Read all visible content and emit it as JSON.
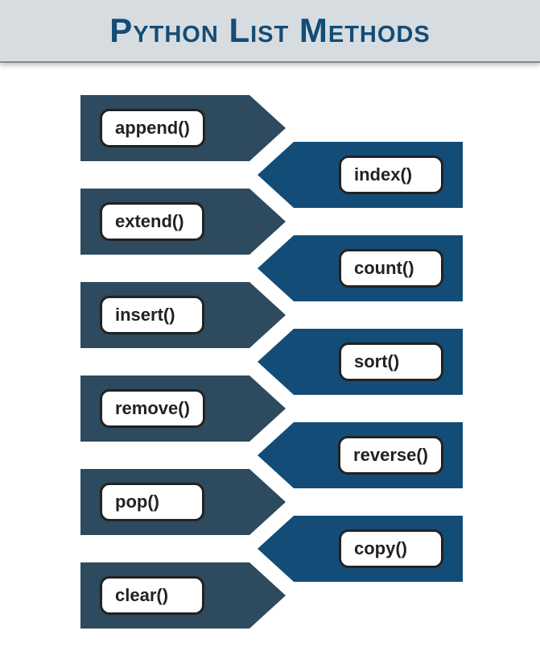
{
  "title": "Python List Methods",
  "left_methods": [
    {
      "label": "append()"
    },
    {
      "label": "extend()"
    },
    {
      "label": "insert()"
    },
    {
      "label": "remove()"
    },
    {
      "label": "pop()"
    },
    {
      "label": "clear()"
    }
  ],
  "right_methods": [
    {
      "label": "index()"
    },
    {
      "label": "count()"
    },
    {
      "label": "sort()"
    },
    {
      "label": "reverse()"
    },
    {
      "label": "copy()"
    }
  ],
  "colors": {
    "header_bg": "#d6dce0",
    "title_color": "#134c77",
    "arrow_dark": "#2d4a5e",
    "arrow_blue": "#134c77"
  }
}
